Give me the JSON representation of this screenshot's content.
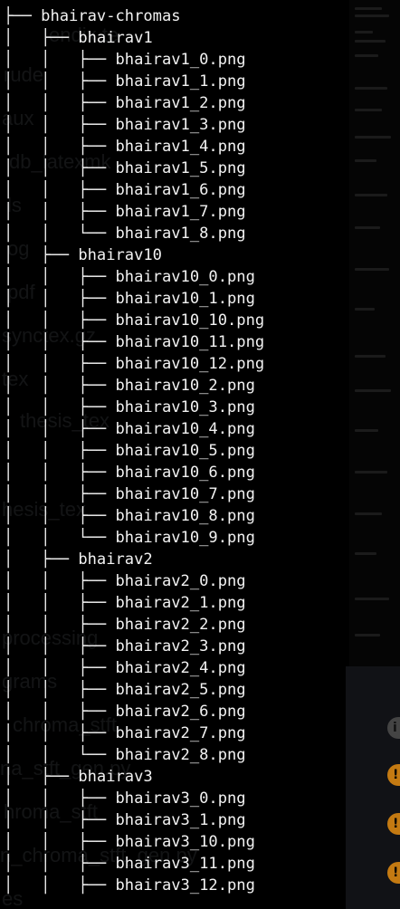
{
  "terminal": {
    "lines": [
      {
        "prefix": "├── ",
        "name": "bhairav-chromas"
      },
      {
        "prefix": "│   ├── ",
        "name": "bhairav1"
      },
      {
        "prefix": "│   │   ├── ",
        "name": "bhairav1_0.png"
      },
      {
        "prefix": "│   │   ├── ",
        "name": "bhairav1_1.png"
      },
      {
        "prefix": "│   │   ├── ",
        "name": "bhairav1_2.png"
      },
      {
        "prefix": "│   │   ├── ",
        "name": "bhairav1_3.png"
      },
      {
        "prefix": "│   │   ├── ",
        "name": "bhairav1_4.png"
      },
      {
        "prefix": "│   │   ├── ",
        "name": "bhairav1_5.png"
      },
      {
        "prefix": "│   │   ├── ",
        "name": "bhairav1_6.png"
      },
      {
        "prefix": "│   │   ├── ",
        "name": "bhairav1_7.png"
      },
      {
        "prefix": "│   │   └── ",
        "name": "bhairav1_8.png"
      },
      {
        "prefix": "│   ├── ",
        "name": "bhairav10"
      },
      {
        "prefix": "│   │   ├── ",
        "name": "bhairav10_0.png"
      },
      {
        "prefix": "│   │   ├── ",
        "name": "bhairav10_1.png"
      },
      {
        "prefix": "│   │   ├── ",
        "name": "bhairav10_10.png"
      },
      {
        "prefix": "│   │   ├── ",
        "name": "bhairav10_11.png"
      },
      {
        "prefix": "│   │   ├── ",
        "name": "bhairav10_12.png"
      },
      {
        "prefix": "│   │   ├── ",
        "name": "bhairav10_2.png"
      },
      {
        "prefix": "│   │   ├── ",
        "name": "bhairav10_3.png"
      },
      {
        "prefix": "│   │   ├── ",
        "name": "bhairav10_4.png"
      },
      {
        "prefix": "│   │   ├── ",
        "name": "bhairav10_5.png"
      },
      {
        "prefix": "│   │   ├── ",
        "name": "bhairav10_6.png"
      },
      {
        "prefix": "│   │   ├── ",
        "name": "bhairav10_7.png"
      },
      {
        "prefix": "│   │   ├── ",
        "name": "bhairav10_8.png"
      },
      {
        "prefix": "│   │   └── ",
        "name": "bhairav10_9.png"
      },
      {
        "prefix": "│   ├── ",
        "name": "bhairav2"
      },
      {
        "prefix": "│   │   ├── ",
        "name": "bhairav2_0.png"
      },
      {
        "prefix": "│   │   ├── ",
        "name": "bhairav2_1.png"
      },
      {
        "prefix": "│   │   ├── ",
        "name": "bhairav2_2.png"
      },
      {
        "prefix": "│   │   ├── ",
        "name": "bhairav2_3.png"
      },
      {
        "prefix": "│   │   ├── ",
        "name": "bhairav2_4.png"
      },
      {
        "prefix": "│   │   ├── ",
        "name": "bhairav2_5.png"
      },
      {
        "prefix": "│   │   ├── ",
        "name": "bhairav2_6.png"
      },
      {
        "prefix": "│   │   ├── ",
        "name": "bhairav2_7.png"
      },
      {
        "prefix": "│   │   └── ",
        "name": "bhairav2_8.png"
      },
      {
        "prefix": "│   ├── ",
        "name": "bhairav3"
      },
      {
        "prefix": "│   │   ├── ",
        "name": "bhairav3_0.png"
      },
      {
        "prefix": "│   │   ├── ",
        "name": "bhairav3_1.png"
      },
      {
        "prefix": "│   │   ├── ",
        "name": "bhairav3_10.png"
      },
      {
        "prefix": "│   │   ├── ",
        "name": "bhairav3_11.png"
      },
      {
        "prefix": "│   │   ├── ",
        "name": "bhairav3_12.png"
      }
    ]
  },
  "background_window": {
    "items": [
      "endix.te",
      "rude",
      "aux",
      "db_latexmk",
      "ls",
      "og",
      "pdf",
      "synctex.gz",
      "tex",
      "thesis_tex",
      "hesis_tex",
      "processing",
      "grams",
      "chroma_stft",
      "na_stft_gen.py",
      "hroma_stft",
      "n_chroma_stft_gen.py",
      "es"
    ]
  },
  "colors": {
    "background": "#000000",
    "text": "#f2f2f2",
    "warning": "#c47a12"
  }
}
